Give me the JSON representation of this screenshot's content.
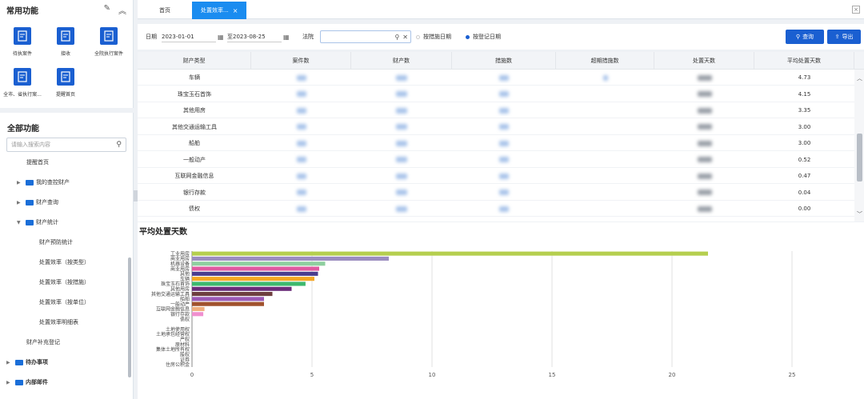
{
  "sidebar": {
    "common_title": "常用功能",
    "favorites": [
      {
        "label": "待执案件"
      },
      {
        "label": "接收"
      },
      {
        "label": "全院执行案件"
      },
      {
        "label": "全市、省执行案..."
      },
      {
        "label": "提醒首页"
      }
    ],
    "all_title": "全部功能",
    "search_placeholder": "请输入搜索内容",
    "tree": [
      {
        "label": "提醒首页",
        "depth": 1
      },
      {
        "label": "我的查控财产",
        "depth": 1
      },
      {
        "label": "财产查询",
        "depth": 1
      },
      {
        "label": "财产统计",
        "depth": 1
      },
      {
        "label": "财产预防统计",
        "depth": 2
      },
      {
        "label": "处置效率（按类型）",
        "depth": 2
      },
      {
        "label": "处置效率（按措施）",
        "depth": 2
      },
      {
        "label": "处置效率（按单位）",
        "depth": 2
      },
      {
        "label": "处置效率明细表",
        "depth": 2
      },
      {
        "label": "财产补充登记",
        "depth": 1
      },
      {
        "label": "待办事项",
        "depth": 0
      },
      {
        "label": "内部邮件",
        "depth": 0
      }
    ]
  },
  "tabs": [
    {
      "label": "首页"
    },
    {
      "label": "处置效率..."
    }
  ],
  "filter": {
    "date_label": "日期",
    "start_date": "2023-01-01",
    "end_date": "至2023-08-25",
    "court_label": "法院",
    "radio_options": [
      "按措施日期",
      "按登记日期"
    ],
    "radio_selected": 1,
    "query_label": "查询",
    "export_label": "导出"
  },
  "table": {
    "columns": [
      "财产类型",
      "案件数",
      "财产数",
      "措施数",
      "超期措施数",
      "处置天数",
      "平均处置天数"
    ],
    "rows": [
      {
        "type": "车辆",
        "avg": "4.73"
      },
      {
        "type": "珠宝玉石首饰",
        "avg": "4.15"
      },
      {
        "type": "其他用房",
        "avg": "3.35"
      },
      {
        "type": "其他交通运输工具",
        "avg": "3.00"
      },
      {
        "type": "船舶",
        "avg": "3.00"
      },
      {
        "type": "一般动产",
        "avg": "0.52"
      },
      {
        "type": "互联网金融信息",
        "avg": "0.47"
      },
      {
        "type": "银行存款",
        "avg": "0.04"
      },
      {
        "type": "债权",
        "avg": "0.00"
      }
    ]
  },
  "chart_data": {
    "type": "bar",
    "orientation": "horizontal",
    "title": "平均处置天数",
    "categories": [
      "工业用房",
      "商业用房",
      "机器设备",
      "商业用房",
      "其他",
      "车辆",
      "珠宝玉石首饰",
      "其他用房",
      "其他交通运输工具",
      "船舶",
      "一般动产",
      "互联网金融信息",
      "银行存款",
      "债权",
      "",
      "土地使用权",
      "土地承包经营权",
      "产权",
      "原材料",
      "集体土地所有权",
      "股权",
      "证券",
      "住房公积金"
    ],
    "values": [
      21.5,
      8.2,
      5.55,
      5.3,
      5.25,
      5.1,
      4.73,
      4.15,
      3.35,
      3.0,
      3.0,
      0.52,
      0.47,
      0.04,
      0,
      0,
      0,
      0,
      0,
      0,
      0,
      0,
      0
    ],
    "colors": [
      "#b5cf4f",
      "#9b8dc0",
      "#8fcf9f",
      "#e05aa0",
      "#4b3d8f",
      "#f5a623",
      "#3db86e",
      "#6b2d7a",
      "#6e3f3f",
      "#9b59b6",
      "#a0522d",
      "#f0b080",
      "#f08fcf",
      "#c9c9c9",
      "#c9c9c9",
      "#c9c9c9",
      "#c9c9c9",
      "#c9c9c9",
      "#c9c9c9",
      "#c9c9c9",
      "#c9c9c9",
      "#c9c9c9",
      "#c9c9c9"
    ],
    "xticks": [
      0,
      5,
      10,
      15,
      20,
      25
    ],
    "xlim": [
      0,
      25
    ]
  }
}
